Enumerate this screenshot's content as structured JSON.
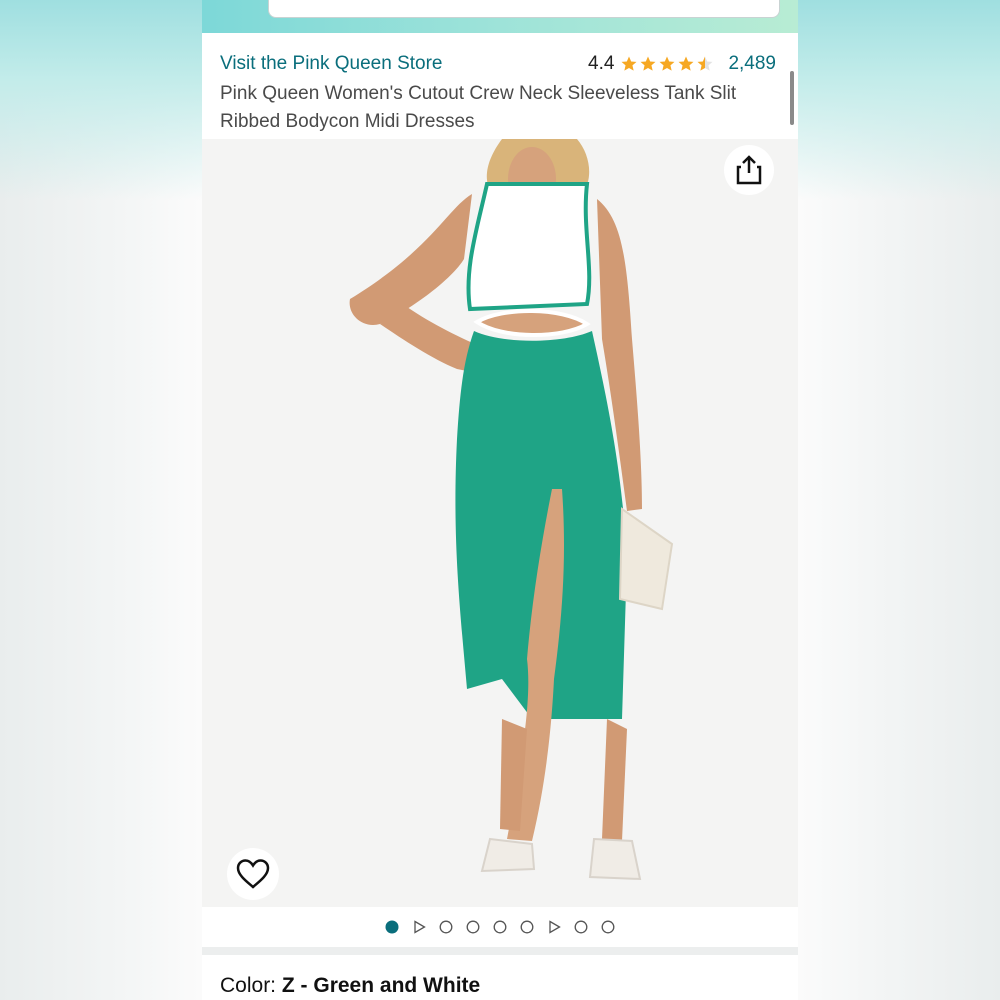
{
  "store": {
    "link_text": "Visit the Pink Queen Store"
  },
  "rating": {
    "value": "4.4",
    "stars": 4.4,
    "count": "2,489"
  },
  "product": {
    "title": "Pink Queen Women's Cutout Crew Neck Sleeveless Tank Slit Ribbed Bodycon Midi Dresses"
  },
  "gallery": {
    "items": [
      "image",
      "video",
      "image",
      "image",
      "image",
      "image",
      "video",
      "image",
      "image"
    ],
    "active_index": 0
  },
  "color": {
    "label": "Color:",
    "value": "Z - Green and White"
  },
  "icons": {
    "share": "share-icon",
    "heart": "heart-icon",
    "star": "star-icon"
  },
  "colors": {
    "link": "#0a6e7c",
    "star": "#f6a823",
    "dot_active": "#0a6e7c",
    "dress_green": "#1fa486"
  }
}
